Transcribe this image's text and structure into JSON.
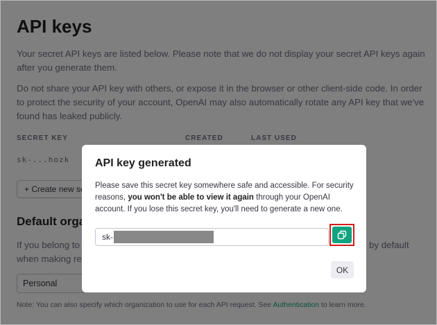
{
  "page": {
    "title": "API keys",
    "intro": "Your secret API keys are listed below. Please note that we do not display your secret API keys again after you generate them.",
    "warning": "Do not share your API key with others, or expose it in the browser or other client-side code. In order to protect the security of your account, OpenAI may also automatically rotate any API key that we've found has leaked publicly.",
    "table": {
      "headers": [
        "SECRET KEY",
        "CREATED",
        "LAST USED"
      ],
      "rows": [
        {
          "secret_key": "sk-...hozk"
        }
      ]
    },
    "create_button": "+ Create new secret key",
    "default_org": {
      "title": "Default organization",
      "description_start": "If you belong to",
      "description_end": "by default",
      "description_line2": "when making requests",
      "select_value": "Personal"
    },
    "note": {
      "text": "Note: You can also specify which organization to use for each API request. See ",
      "link": "Authentication",
      "suffix": " to learn more."
    }
  },
  "modal": {
    "title": "API key generated",
    "text_before": "Please save this secret key somewhere safe and accessible. For security reasons, ",
    "text_bold": "you won't be able to view it again",
    "text_after": " through your OpenAI account. If you lose this secret key, you'll need to generate a new one.",
    "key_prefix": "sk-",
    "copy_icon": "copy-icon",
    "ok_label": "OK"
  },
  "colors": {
    "accent": "#10a37f",
    "highlight": "#d41a1a",
    "overlay": "rgba(0,0,0,0.5)"
  }
}
